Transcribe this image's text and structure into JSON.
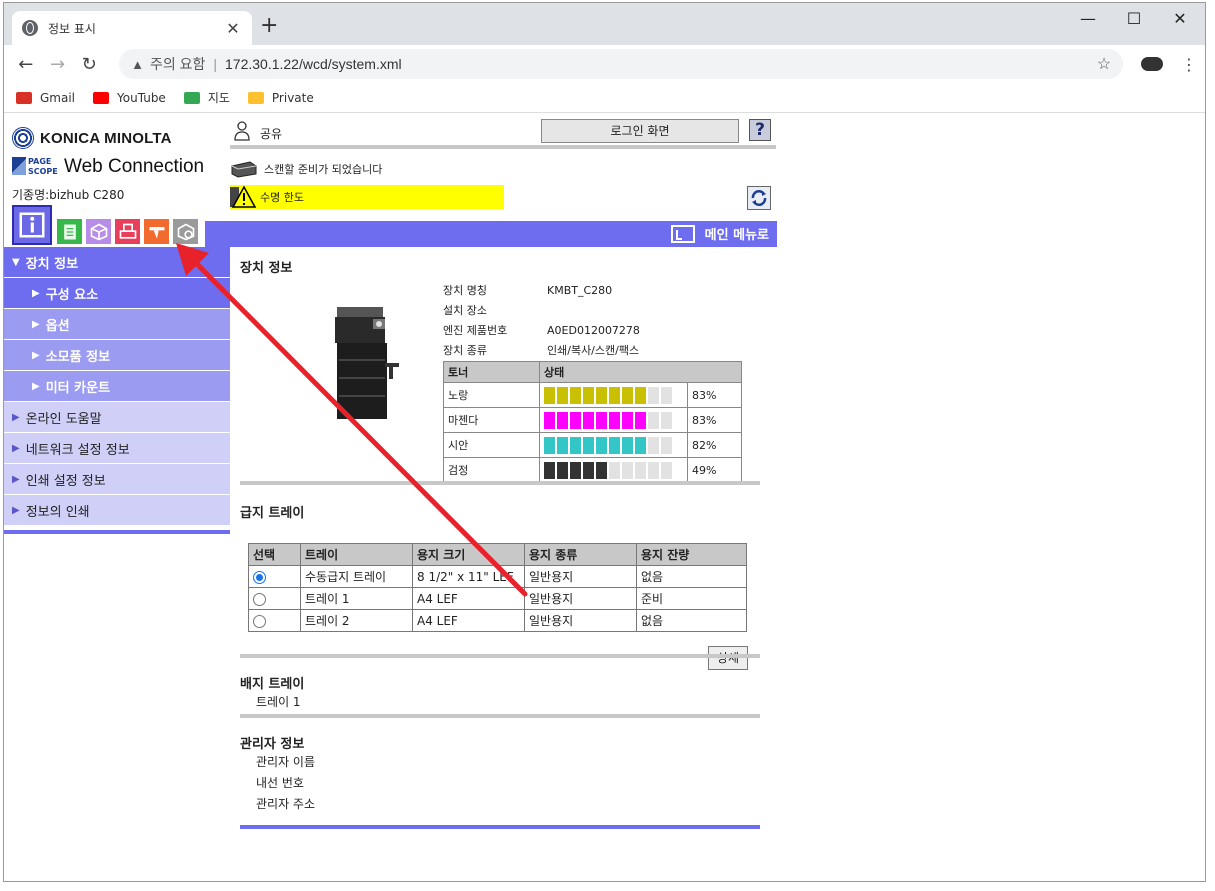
{
  "browser": {
    "tab_title": "정보 표시",
    "tab_close": "✕",
    "new_tab": "+",
    "minimize": "—",
    "maximize": "☐",
    "close": "✕",
    "back": "←",
    "forward": "→",
    "reload": "↻",
    "security_warning": "주의 요함",
    "url": "172.30.1.22/wcd/system.xml",
    "star": "☆",
    "menu": "⋮",
    "bookmarks": [
      {
        "label": "Gmail",
        "color": "#d93025"
      },
      {
        "label": "YouTube",
        "color": "#ff0000"
      },
      {
        "label": "지도",
        "color": "#34a853"
      },
      {
        "label": "Private",
        "color": "#fbc02d"
      }
    ]
  },
  "header": {
    "brand": "KONICA MINOLTA",
    "pagescope": "PAGE SCOPE",
    "product": "Web Connection",
    "model": "기종명:bizhub C280",
    "user": "공유",
    "login_button": "로그인 화면",
    "help": "?",
    "status_ready": "스캔할 준비가 되었습니다",
    "status_warning": "수명 한도",
    "main_menu": "메인 메뉴로"
  },
  "icon_tabs": [
    {
      "name": "info",
      "color": "#6b69e6"
    },
    {
      "name": "job",
      "color": "#38b84a"
    },
    {
      "name": "box",
      "color": "#b78de8"
    },
    {
      "name": "print",
      "color": "#e8405a"
    },
    {
      "name": "scan",
      "color": "#f26a2e"
    },
    {
      "name": "admin",
      "color": "#9a9a9a"
    }
  ],
  "sidebar": {
    "items": [
      {
        "label": "장치 정보",
        "kind": "head"
      },
      {
        "label": "구성 요소",
        "kind": "sub-current"
      },
      {
        "label": "옵션",
        "kind": "sub"
      },
      {
        "label": "소모품 정보",
        "kind": "sub"
      },
      {
        "label": "미터 카운트",
        "kind": "sub"
      },
      {
        "label": "온라인 도움말",
        "kind": "top"
      },
      {
        "label": "네트워크 설정 정보",
        "kind": "top"
      },
      {
        "label": "인쇄 설정 정보",
        "kind": "top"
      },
      {
        "label": "정보의 인쇄",
        "kind": "top"
      }
    ]
  },
  "device": {
    "title": "장치 정보",
    "fields": [
      {
        "k": "장치 명칭",
        "v": "KMBT_C280"
      },
      {
        "k": "설치 장소",
        "v": ""
      },
      {
        "k": "엔진 제품번호",
        "v": "A0ED012007278"
      },
      {
        "k": "장치 종류",
        "v": "인쇄/복사/스캔/팩스"
      }
    ],
    "toner_header": [
      "토너",
      "상태"
    ],
    "toners": [
      {
        "name": "노랑",
        "pct_text": "83%",
        "level": 0.83,
        "color": "#c8c000"
      },
      {
        "name": "마젠다",
        "pct_text": "83%",
        "level": 0.83,
        "color": "#ff00ff"
      },
      {
        "name": "시안",
        "pct_text": "82%",
        "level": 0.82,
        "color": "#33c6c6"
      },
      {
        "name": "검정",
        "pct_text": "49%",
        "level": 0.49,
        "color": "#333333"
      }
    ]
  },
  "trays": {
    "title": "급지 트레이",
    "headers": [
      "선택",
      "트레이",
      "용지 크기",
      "용지 종류",
      "용지 잔량"
    ],
    "rows": [
      {
        "selected": true,
        "tray": "수동급지 트레이",
        "size": "8 1/2\" x 11\" LEF",
        "type": "일반용지",
        "remain": "없음"
      },
      {
        "selected": false,
        "tray": "트레이 1",
        "size": "A4 LEF",
        "type": "일반용지",
        "remain": "준비"
      },
      {
        "selected": false,
        "tray": "트레이 2",
        "size": "A4 LEF",
        "type": "일반용지",
        "remain": "없음"
      }
    ],
    "detail_button": "상세"
  },
  "output": {
    "title": "배지 트레이",
    "items": [
      "트레이 1"
    ]
  },
  "admin": {
    "title": "관리자 정보",
    "items": [
      "관리자 이름",
      "내선 번호",
      "관리자 주소"
    ]
  },
  "annotation": {
    "arrow_color": "#e8222a"
  }
}
